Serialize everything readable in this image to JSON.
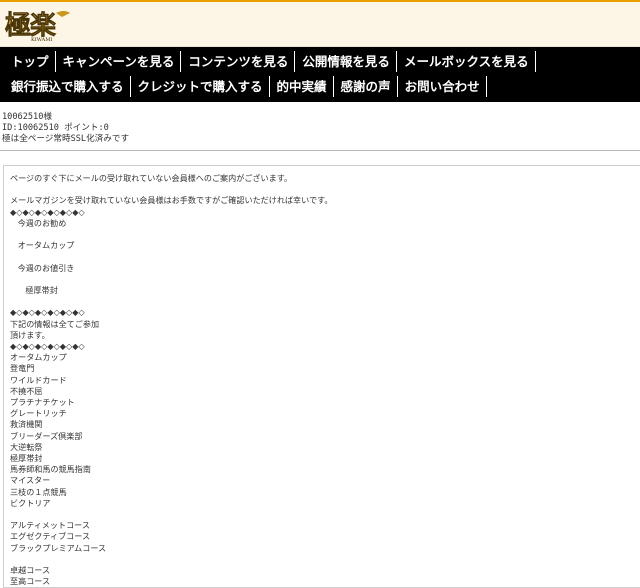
{
  "header": {
    "logo_text": "極楽",
    "logo_sub": "KIWAMI"
  },
  "nav": {
    "row1": [
      "トップ",
      "キャンペーンを見る",
      "コンテンツを見る",
      "公開情報を見る",
      "メールボックスを見る"
    ],
    "row2": [
      "銀行振込で購入する",
      "クレジットで購入する",
      "的中実績",
      "感謝の声",
      "お問い合わせ"
    ]
  },
  "user": {
    "name": "10062510様",
    "id_points": "ID:10062510 ポイント:0",
    "ssl_note": "極は全ページ常時SSL化済みです"
  },
  "content": {
    "lines": [
      "ページのすぐ下にメールの受け取れていない会員様へのご案内がございます。",
      "",
      "メールマガジンを受け取れていない会員様はお手数ですがご確認いただければ幸いです。",
      "◆◇◆◇◆◇◆◇◆◇◆◇",
      "   今週のお勧め",
      "",
      "   オータムカップ",
      "",
      "   今週のお値引き",
      "",
      "      極厚帯封",
      "",
      "◆◇◆◇◆◇◆◇◆◇◆◇",
      "下記の情報は全てご参加",
      "頂けます。",
      "◆◇◆◇◆◇◆◇◆◇◆◇",
      "オータムカップ",
      "登竜門",
      "ワイルドカード",
      "不撓不屈",
      "プラチナチケット",
      "グレートリッチ",
      "救済機関",
      "ブリーダーズ倶楽部",
      "大逆転祭",
      "極厚帯封",
      "馬券師和馬の競馬指南",
      "マイスター",
      "三枝の１点競馬",
      "ビクトリア",
      "",
      "アルティメットコース",
      "エグゼクティブコース",
      "ブラックプレミアムコース",
      "",
      "卓越コース",
      "至高コース"
    ]
  }
}
